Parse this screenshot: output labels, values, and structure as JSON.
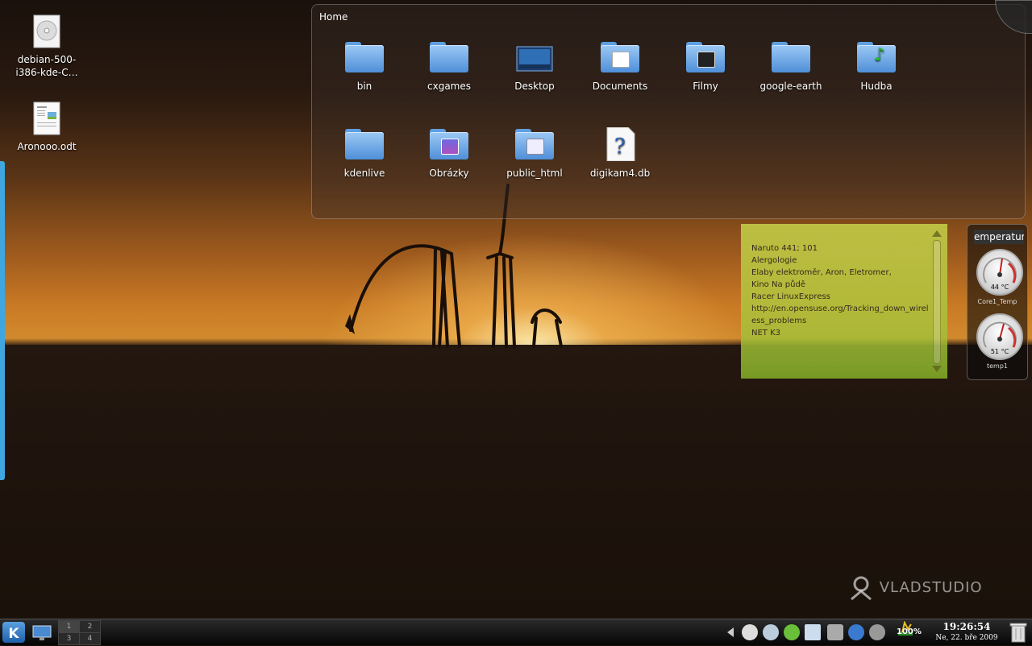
{
  "desktop": {
    "icons": [
      {
        "label": "debian-500-\ni386-kde-C…",
        "icon": "cd-icon"
      },
      {
        "label": "Aronooo.odt",
        "icon": "document-icon"
      }
    ]
  },
  "folderview": {
    "title": "Home",
    "items": [
      {
        "label": "bin",
        "icon": "folder-icon"
      },
      {
        "label": "cxgames",
        "icon": "folder-icon"
      },
      {
        "label": "Desktop",
        "icon": "desktop-folder-icon"
      },
      {
        "label": "Documents",
        "icon": "documents-folder-icon"
      },
      {
        "label": "Filmy",
        "icon": "movies-folder-icon"
      },
      {
        "label": "google-earth",
        "icon": "folder-icon"
      },
      {
        "label": "Hudba",
        "icon": "music-folder-icon"
      },
      {
        "label": "kdenlive",
        "icon": "folder-icon"
      },
      {
        "label": "Obrázky",
        "icon": "pictures-folder-icon"
      },
      {
        "label": "public_html",
        "icon": "web-folder-icon"
      },
      {
        "label": "digikam4.db",
        "icon": "unknown-file-icon"
      }
    ]
  },
  "notes": {
    "lines": [
      "Naruto 441; 101",
      "Alergologie",
      "Elaby elektroměr, Aron, Eletromer,",
      "Kino Na půdě",
      "Racer LinuxExpress",
      "http://en.opensuse.org/Tracking_down_wirel",
      "ess_problems",
      "NET K3"
    ]
  },
  "temperature": {
    "title": "emperatur",
    "sensors": [
      {
        "value": "44 °C",
        "label": "Core1_Temp",
        "level": 0.44
      },
      {
        "value": "51 °C",
        "label": "temp1",
        "level": 0.51
      }
    ]
  },
  "taskbar": {
    "pager": [
      "1",
      "2",
      "3",
      "4"
    ],
    "battery": "100%",
    "clock_time": "19:26:54",
    "clock_date": "Ne, 22. bře 2009"
  },
  "watermark": "VLADSTUDIO",
  "colors": {
    "panel_blue": "#3fa6e0",
    "folder_blue": "#6aa8ea",
    "notes_green": "#b4c63e"
  }
}
